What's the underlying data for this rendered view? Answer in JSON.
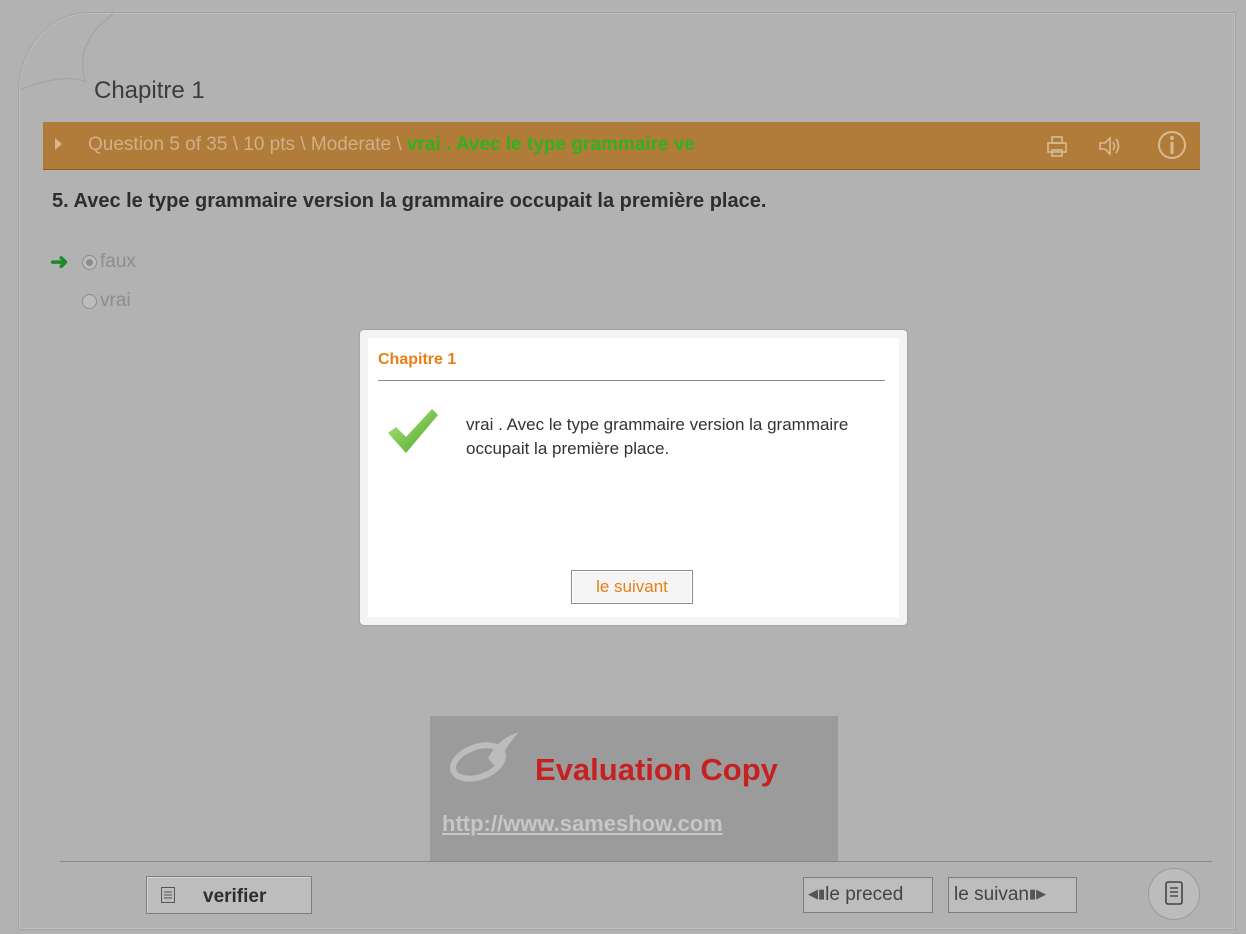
{
  "chapter": {
    "title": "Chapitre 1"
  },
  "question_bar": {
    "info": "Question 5 of 35 \\ 10 pts \\ Moderate \\ ",
    "answer_excerpt": "vrai . Avec le type grammaire ve",
    "icons": [
      "printer-icon",
      "speaker-icon",
      "info-icon"
    ]
  },
  "question": {
    "text": "5. Avec le type grammaire version la grammaire occupait la première place.",
    "options": [
      {
        "label": "faux",
        "selected": true
      },
      {
        "label": "vrai",
        "selected": false
      }
    ]
  },
  "dialog": {
    "title": "Chapitre 1",
    "message": "vrai . Avec le type grammaire version la grammaire occupait la première place.",
    "button_label": "le suivant"
  },
  "watermark": {
    "title": "Evaluation Copy",
    "url": "http://www.sameshow.com"
  },
  "footer": {
    "verify_label": "verifier",
    "prev_label": "le preced",
    "next_label": "le suivan"
  },
  "colors": {
    "background": "#b2b2b2",
    "question_bar": "#b17c3a",
    "answer_green": "#2fb21d",
    "dialog_accent": "#e77f14",
    "watermark_red": "#c62121"
  }
}
